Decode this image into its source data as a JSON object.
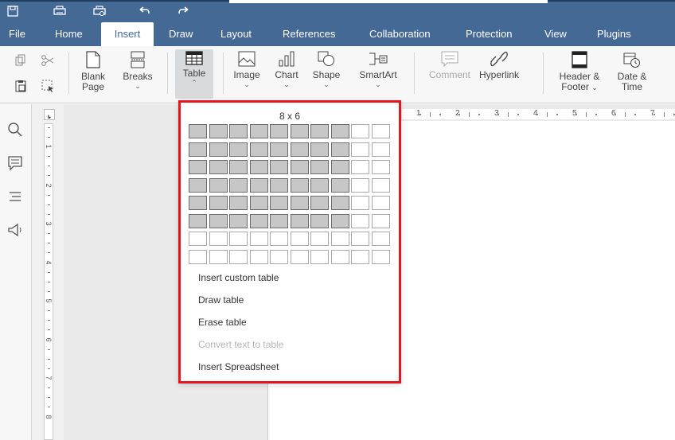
{
  "tabs": [
    {
      "label": "File"
    },
    {
      "label": "Home"
    },
    {
      "label": "Insert",
      "active": true
    },
    {
      "label": "Draw"
    },
    {
      "label": "Layout"
    },
    {
      "label": "References"
    },
    {
      "label": "Collaboration"
    },
    {
      "label": "Protection"
    },
    {
      "label": "View"
    },
    {
      "label": "Plugins"
    }
  ],
  "toolbar": {
    "blank_page": "Blank",
    "blank_page2": "Page",
    "breaks": "Breaks",
    "table": "Table",
    "image": "Image",
    "chart": "Chart",
    "shape": "Shape",
    "smartart": "SmartArt",
    "comment": "Comment",
    "hyperlink": "Hyperlink",
    "header_footer": "Header &",
    "header_footer2": "Footer",
    "date_time": "Date &",
    "date_time2": "Time"
  },
  "table_dropdown": {
    "size_label": "8 x 6",
    "rows": 8,
    "cols": 10,
    "selected_cols": 8,
    "selected_rows": 6,
    "items": [
      {
        "label": "Insert custom table",
        "enabled": true
      },
      {
        "label": "Draw table",
        "enabled": true
      },
      {
        "label": "Erase table",
        "enabled": true
      },
      {
        "label": "Convert text to table",
        "enabled": false
      },
      {
        "label": "Insert Spreadsheet",
        "enabled": true
      }
    ]
  },
  "ruler": {
    "h_numbers": [
      "1",
      "2",
      "3",
      "4",
      "5",
      "6",
      "7"
    ],
    "v_numbers": [
      "1",
      "2",
      "3",
      "4",
      "5",
      "6",
      "7",
      "8"
    ]
  },
  "colors": {
    "header_blue": "#446995",
    "highlight_red": "#e3151f"
  }
}
